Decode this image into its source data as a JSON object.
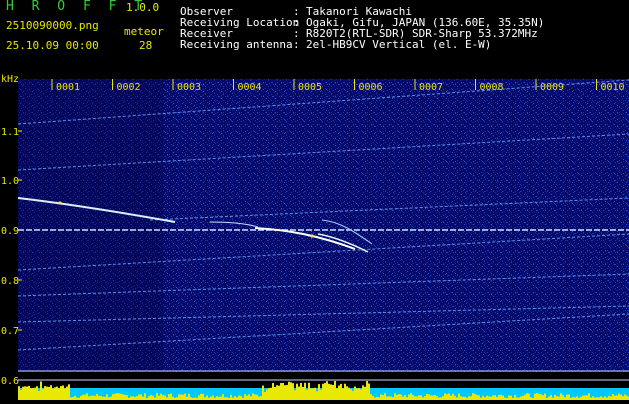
{
  "app": {
    "name": "H R O F F T",
    "version": "1.0.0",
    "filename": "2510090000.png",
    "datetime": "25.10.09 00:00",
    "meteor_label": "meteor",
    "meteor_count": "28"
  },
  "info": {
    "rows": [
      {
        "key": "Observer",
        "sep": ":",
        "value": "Takanori Kawachi"
      },
      {
        "key": "Receiving Location",
        "sep": ":",
        "value": "Ogaki, Gifu, JAPAN (136.60E, 35.35N)"
      },
      {
        "key": "Receiver",
        "sep": ":",
        "value": "R820T2(RTL-SDR) SDR-Sharp 53.372MHz"
      },
      {
        "key": "Receiving antenna",
        "sep": ":",
        "value": "2el-HB9CV Vertical (el. E-W)"
      }
    ]
  },
  "colors": {
    "background": "#000000",
    "plot_bg": "#050a6a",
    "title_green": "#2fd02f",
    "label_yellow": "#e8e800",
    "text_white": "#ffffff",
    "signal_cyan": "#9fd0ff",
    "bar_yellow": "#e8e800",
    "bar_cyan": "#00c8ff"
  },
  "spectrogram": {
    "unit_label": "kHz",
    "y_ticks": [
      "1.1",
      "1.0",
      "0.9",
      "0.8",
      "0.7",
      "0.6"
    ],
    "x_ticks": [
      "0001",
      "0002",
      "0003",
      "0004",
      "0005",
      "0006",
      "0007",
      "0008",
      "0009",
      "0010"
    ]
  }
}
